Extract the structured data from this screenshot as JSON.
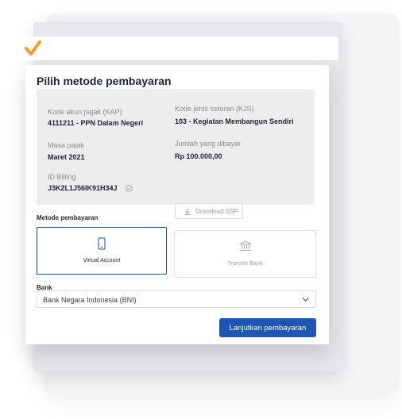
{
  "colors": {
    "accent": "#1f56b1",
    "selected_border": "#1f4d8f",
    "check_orange": "#f29a2e",
    "panel_bg": "#ededee"
  },
  "title": "Pilih metode pembayaran",
  "billing": {
    "kap_label": "Kode akun pajak (KAP)",
    "kap_value": "4111211 - PPN Dalam Negeri",
    "kjs_label": "Kode jenis setoran (KJS)",
    "kjs_value": "103 - Kegiatan Membangun Sendiri",
    "masa_label": "Masa pajak",
    "masa_value": "Maret 2021",
    "jumlah_label": "Jumlah yang dibayar",
    "jumlah_value": "Rp 100.000,00",
    "id_label": "ID Billing",
    "id_value": "J3K2L1J56IK91H34J",
    "download_label": "Download SSP"
  },
  "methods": {
    "section_label": "Metode pembayaran",
    "items": [
      {
        "label": "Virtual Account",
        "icon": "phone-icon",
        "selected": true
      },
      {
        "label": "Transfer Bank",
        "icon": "bank-icon",
        "selected": false
      }
    ]
  },
  "bank": {
    "label": "Bank",
    "selected": "Bank Negara Indonesia (BNI)"
  },
  "submit_label": "Lanjutkan pembayaran"
}
